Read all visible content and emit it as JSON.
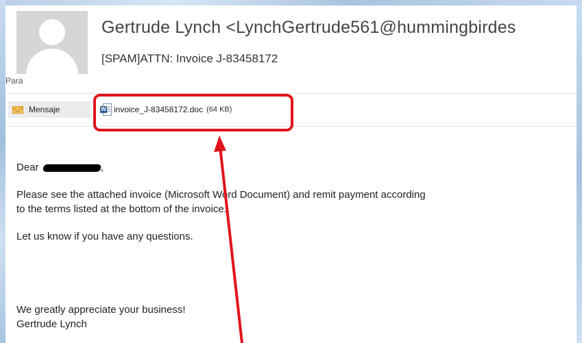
{
  "email": {
    "sender": "Gertrude Lynch <LynchGertrude561@hummingbirdes",
    "subject": "[SPAM]ATTN: Invoice J-83458172",
    "to_label": "Para"
  },
  "tabs": {
    "message_label": "Mensaje",
    "attachment_name": "invoice_J-83458172.doc",
    "attachment_size": "(64 KB)"
  },
  "body": {
    "greeting_prefix": "Dear",
    "greeting_suffix": ",",
    "line1": "Please see the attached invoice (Microsoft Word Document) and remit payment according",
    "line2": "to the terms listed at the bottom of the invoice.",
    "line3": "Let us know if you have any questions.",
    "closing": "We greatly appreciate your business!",
    "signature": "Gertrude Lynch"
  },
  "annotation": {
    "color": "#e1141c"
  },
  "icons": {
    "avatar": "default-person-avatar",
    "message": "envelope-icon",
    "attachment": "word-document-icon"
  }
}
